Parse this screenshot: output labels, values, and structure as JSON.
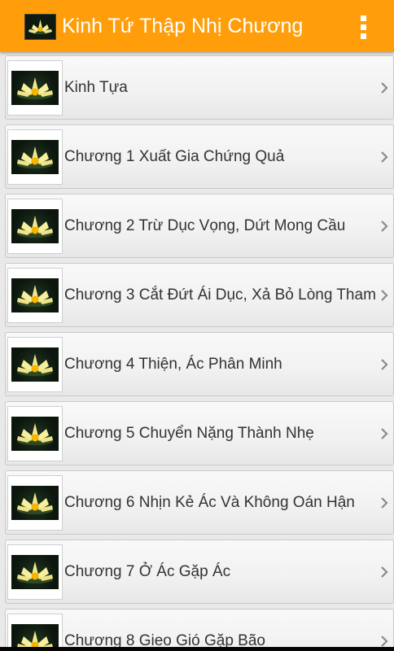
{
  "app": {
    "title": "Kinh Tứ Thập Nhị Chương",
    "icon": "lotus-flower-icon",
    "menu_icon": "overflow-menu-icon",
    "accent_color": "#ff9e0a"
  },
  "chapters": [
    {
      "label": "Kinh Tựa",
      "thumbnail": "lotus-flower-icon"
    },
    {
      "label": "Chương 1  Xuất Gia Chứng Quả",
      "thumbnail": "lotus-flower-icon"
    },
    {
      "label": "Chương 2  Trừ Dục Vọng, Dứt Mong Cầu",
      "thumbnail": "lotus-flower-icon"
    },
    {
      "label": "Chương 3  Cắt Đứt Ái Dục, Xả Bỏ Lòng Tham",
      "thumbnail": "lotus-flower-icon"
    },
    {
      "label": "Chương 4  Thiện, Ác Phân Minh",
      "thumbnail": "lotus-flower-icon"
    },
    {
      "label": "Chương 5  Chuyển Nặng Thành Nhẹ",
      "thumbnail": "lotus-flower-icon"
    },
    {
      "label": "Chương 6  Nhịn Kẻ Ác Và Không Oán Hận",
      "thumbnail": "lotus-flower-icon"
    },
    {
      "label": "Chương 7  Ở Ác Gặp Ác",
      "thumbnail": "lotus-flower-icon"
    },
    {
      "label": "Chương 8  Gieo Gió Gặp Bão",
      "thumbnail": "lotus-flower-icon"
    }
  ]
}
